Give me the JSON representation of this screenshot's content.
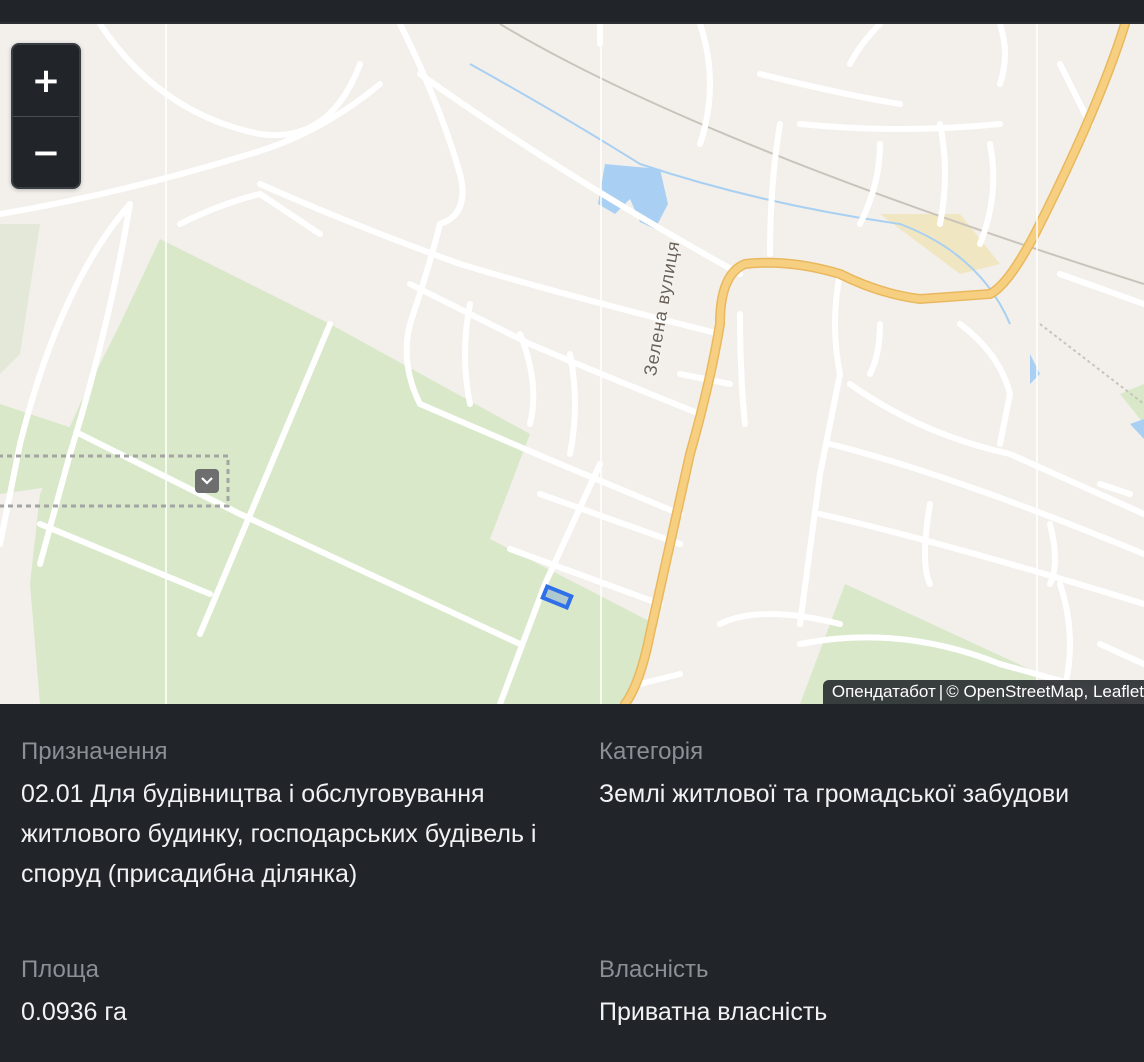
{
  "map": {
    "street_label": "Зелена вулиця",
    "zoom_in_label": "+",
    "zoom_out_label": "−",
    "attribution": {
      "provider": "Опендатабот",
      "separator": "|",
      "osm": "© OpenStreetMap,",
      "leaflet": "Leaflet"
    },
    "layer_toggle_icon": "chevron-down-icon",
    "parcel_color": "#2f6fe8",
    "road_color": "#f6c66e",
    "green_color": "#d6e7c7",
    "water_color": "#a9d0f2"
  },
  "details": {
    "purpose": {
      "label": "Призначення",
      "value": "02.01 Для будівництва і обслуговування житлового будинку, господарських будівель і споруд (присадибна ділянка)"
    },
    "category": {
      "label": "Категорія",
      "value": "Землі житлової та громадської забудови"
    },
    "area": {
      "label": "Площа",
      "value": "0.0936 га"
    },
    "ownership": {
      "label": "Власність",
      "value": "Приватна власність"
    }
  }
}
